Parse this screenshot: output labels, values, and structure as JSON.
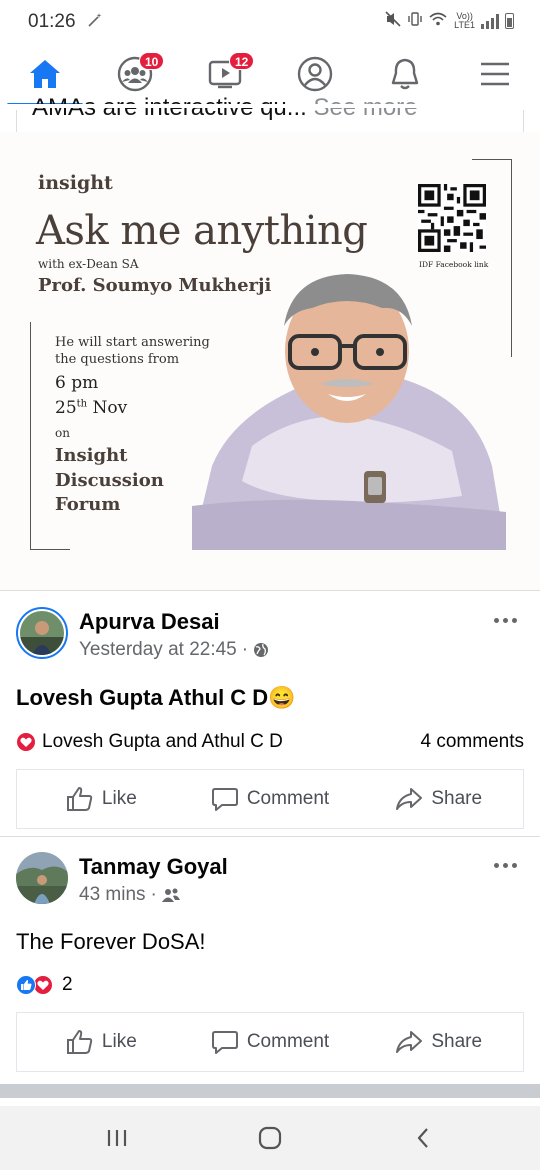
{
  "status_bar": {
    "time": "01:26",
    "network_top": "Vo))",
    "network_bottom": "LTE1"
  },
  "nav": {
    "items": [
      {
        "name": "home",
        "icon": "home-icon",
        "active": true
      },
      {
        "name": "groups",
        "icon": "groups-icon",
        "badge": "10"
      },
      {
        "name": "watch",
        "icon": "video-icon",
        "badge": "12"
      },
      {
        "name": "profile",
        "icon": "profile-icon"
      },
      {
        "name": "notifications",
        "icon": "bell-icon"
      },
      {
        "name": "menu",
        "icon": "hamburger-icon"
      }
    ]
  },
  "post0": {
    "snippet": "AMAs are interactive qu...",
    "see_more": " See more",
    "poster": {
      "brand": "insight",
      "headline": "Ask me anything",
      "with_line": "with ex-Dean SA",
      "professor": "Prof. Soumyo Mukherji",
      "start_text": "He will start answering the questions from",
      "time": "6 pm",
      "date_day": "25",
      "date_suffix": "th",
      "date_month": " Nov",
      "on": "on",
      "forum": "Insight Discussion Forum",
      "qr_label": "IDF Facebook link"
    }
  },
  "post1": {
    "author": "Apurva Desai",
    "time": "Yesterday at 22:45",
    "separator": "·",
    "privacy_icon": "globe-icon",
    "text": "Lovesh Gupta Athul C D😄",
    "reactions_who": "Lovesh Gupta and Athul C D",
    "comments": "4 comments",
    "actions": {
      "like": "Like",
      "comment": "Comment",
      "share": "Share"
    }
  },
  "post2": {
    "author": "Tanmay Goyal",
    "time": "43 mins",
    "separator": "·",
    "privacy_icon": "friends-icon",
    "text": "The Forever DoSA!",
    "reaction_count": "2",
    "actions": {
      "like": "Like",
      "comment": "Comment",
      "share": "Share"
    }
  },
  "colors": {
    "accent": "#1877f2",
    "badge": "#e41e3f",
    "secondary_text": "#65676b",
    "poster_text": "#4a3f39"
  }
}
